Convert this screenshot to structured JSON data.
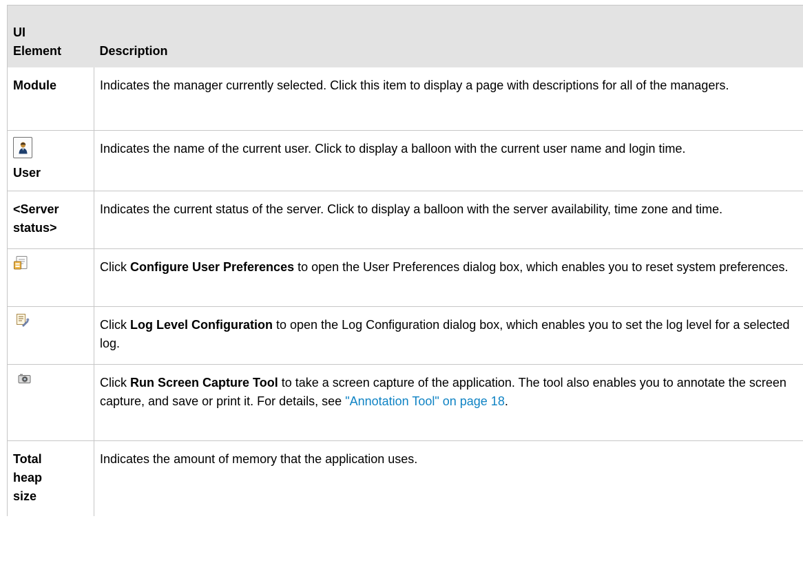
{
  "table": {
    "header": {
      "col1": "UI Element",
      "col1_line1": "UI",
      "col1_line2": "Element",
      "col2": "Description"
    },
    "rows": [
      {
        "element": "Module",
        "description": "Indicates the manager currently selected. Click this item to display a page with descriptions for all of the managers."
      },
      {
        "element": "User",
        "icon": "user-icon",
        "description": "Indicates the name of the current user. Click to display a balloon with the current user name and login time."
      },
      {
        "element": "<Server status>",
        "element_line1": "<Server",
        "element_line2": "status>",
        "description": "Indicates the current status of the server. Click to display a balloon with the server availability, time zone and time."
      },
      {
        "icon": "user-preferences-icon",
        "description_pre": "Click ",
        "description_bold": "Configure User Preferences",
        "description_post": " to open the User Preferences dialog box, which enables you to reset system preferences."
      },
      {
        "icon": "log-configuration-icon",
        "description_pre": "Click ",
        "description_bold": "Log Level Configuration",
        "description_post": " to open the Log Configuration dialog box, which enables you to set the log level for a selected log."
      },
      {
        "icon": "camera-icon",
        "description_pre": "Click ",
        "description_bold": "Run Screen Capture Tool",
        "description_post": " to take a screen capture of the application. The tool also enables you to annotate the screen capture, and save or print it. For details, see ",
        "description_link": "\"Annotation Tool\" on page 18",
        "description_end": "."
      },
      {
        "element": "Total heap size",
        "element_line1": "Total",
        "element_line2": "heap",
        "element_line3": "size",
        "description": "Indicates the amount of memory that the application uses."
      }
    ]
  },
  "colors": {
    "header_bg": "#e3e3e3",
    "border": "#c6c6c6",
    "link": "#0f83c4"
  }
}
